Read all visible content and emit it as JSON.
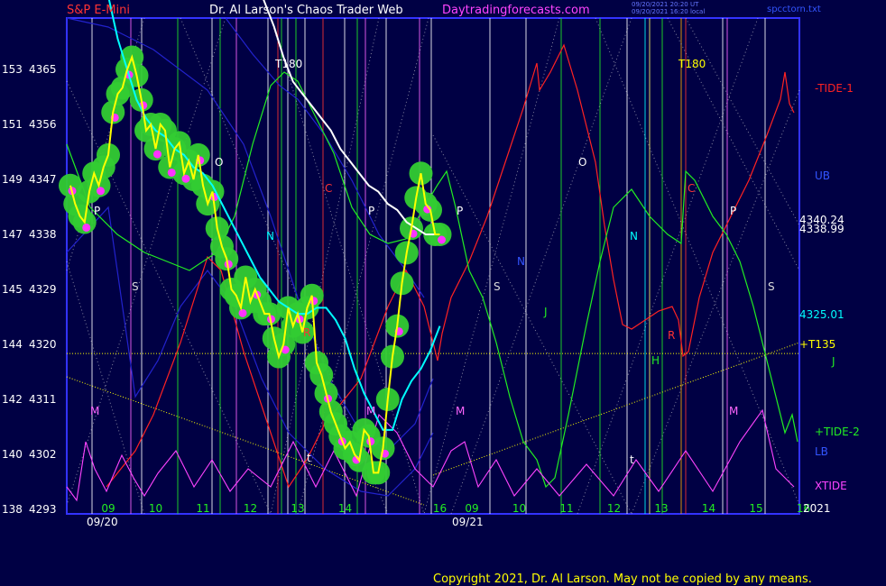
{
  "header": {
    "left_title": "S&P E-Mini",
    "center_title": "Dr. Al Larson's Chaos Trader Web",
    "site": "Daytradingforecasts.com",
    "timestamp_1": "09/20/2021 20:20 UT",
    "timestamp_2": "09/20/2021 16:20 local",
    "file_name": "spcctorn.txt"
  },
  "footer": {
    "copyright": "Copyright 2021, Dr. Al Larson. May not be copied by any means."
  },
  "colors": {
    "background": "#000044",
    "frame": "#3333ff",
    "price": "#ffff00",
    "ma_fast": "#00ffff",
    "ma_slow": "#ffffff",
    "tide1": "#ff2222",
    "tide2": "#22ee22",
    "xtide": "#ff44ff",
    "bands": "#2222cc",
    "highlight_green": "#33cc33",
    "highlight_magenta": "#ff33ff",
    "trend_dotted": "#ffff00"
  },
  "chart_data": {
    "type": "line",
    "title": "S&P E-Mini",
    "ylim": [
      4293,
      4370
    ],
    "y_ticks": [
      {
        "cycle": "153",
        "price": "4365",
        "v": 4365
      },
      {
        "cycle": "151",
        "price": "4356",
        "v": 4356
      },
      {
        "cycle": "149",
        "price": "4347",
        "v": 4347
      },
      {
        "cycle": "147",
        "price": "4338",
        "v": 4338
      },
      {
        "cycle": "145",
        "price": "4329",
        "v": 4329
      },
      {
        "cycle": "144",
        "price": "4320",
        "v": 4320
      },
      {
        "cycle": "142",
        "price": "4311",
        "v": 4311
      },
      {
        "cycle": "140",
        "price": "4302",
        "v": 4302
      },
      {
        "cycle": "138",
        "price": "4293",
        "v": 4293
      }
    ],
    "xlim": [
      8.0,
      16.9
    ],
    "x_ticks": [
      {
        "label": "09",
        "t": 8.8
      },
      {
        "label": "10",
        "t": 9.8
      },
      {
        "label": "11",
        "t": 10.8
      },
      {
        "label": "12",
        "t": 11.8
      },
      {
        "label": "13",
        "t": 12.8
      },
      {
        "label": "14",
        "t": 13.8
      },
      {
        "label": "16",
        "t": 15.8
      },
      {
        "label": "09",
        "t": 8.8,
        "day": 2
      },
      {
        "label": "10",
        "t": 9.8,
        "day": 2
      },
      {
        "label": "11",
        "t": 10.8,
        "day": 2
      },
      {
        "label": "12",
        "t": 11.8,
        "day": 2
      },
      {
        "label": "13",
        "t": 12.8,
        "day": 2
      },
      {
        "label": "14",
        "t": 13.8,
        "day": 2
      },
      {
        "label": "15",
        "t": 14.8,
        "day": 2
      },
      {
        "label": "16",
        "t": 15.8,
        "day": 2
      }
    ],
    "date_labels": [
      "09/20",
      "09/21"
    ],
    "year_label": "2021",
    "right_labels": {
      "tide1": "-TIDE-1",
      "ub": "UB",
      "p1": "4340.24",
      "p2": "4338.99",
      "p3": "4325.01",
      "t135": "+T135",
      "j": "J",
      "tide2": "+TIDE-2",
      "lb": "LB",
      "xtide": "XTIDE"
    },
    "t180_labels": [
      "T180",
      "T180"
    ],
    "level_line": 4318.5,
    "series": [
      {
        "name": "price",
        "x": [
          8.0,
          8.1,
          8.2,
          8.3,
          8.4,
          8.5,
          8.6,
          8.7,
          8.8,
          8.9,
          9.0,
          9.1,
          9.2,
          9.3,
          9.4,
          9.5,
          9.6,
          9.7,
          9.8,
          9.9,
          10.0,
          10.1,
          10.2,
          10.3,
          10.4,
          10.5,
          10.6,
          10.7,
          10.8,
          10.9,
          11.0,
          11.1,
          11.2,
          11.3,
          11.4,
          11.5,
          11.6,
          11.7,
          11.8,
          11.9,
          12.0,
          12.1,
          12.2,
          12.3,
          12.4,
          12.5,
          12.6,
          12.7,
          12.8,
          12.9,
          13.0,
          13.1,
          13.2,
          13.3,
          13.4,
          13.5,
          13.6,
          13.7,
          13.8,
          13.9,
          14.0,
          14.1,
          14.2,
          14.3,
          14.4,
          14.5,
          14.6,
          14.7,
          14.8,
          14.9,
          15.0,
          15.1,
          15.2,
          15.3,
          15.4,
          15.5,
          15.6,
          15.7,
          15.8
        ],
        "values": [
          4346,
          4343,
          4341,
          4340,
          4345,
          4348,
          4346,
          4349,
          4351,
          4358,
          4361,
          4362,
          4365,
          4367,
          4364,
          4360,
          4355,
          4356,
          4352,
          4356,
          4355,
          4349,
          4352,
          4353,
          4348,
          4350,
          4347,
          4351,
          4346,
          4343,
          4345,
          4339,
          4336,
          4334,
          4329,
          4328,
          4326,
          4331,
          4327,
          4329,
          4327,
          4325,
          4325,
          4321,
          4318,
          4320,
          4326,
          4323,
          4325,
          4322,
          4326,
          4328,
          4317,
          4315,
          4312,
          4309,
          4307,
          4305,
          4303,
          4304,
          4302,
          4301,
          4306,
          4305,
          4299,
          4299,
          4303,
          4311,
          4318,
          4323,
          4330,
          4335,
          4339,
          4344,
          4348,
          4343,
          4342,
          4338,
          4338
        ]
      },
      {
        "name": "ma_fast",
        "x": [
          8.8,
          9.0,
          9.2,
          9.4,
          9.6,
          9.8,
          10.0,
          10.2,
          10.4,
          10.6,
          10.8,
          11.0,
          11.2,
          11.4,
          11.6,
          11.8,
          12.0,
          12.2,
          12.4,
          12.6,
          12.8,
          13.0,
          13.2,
          13.4,
          13.6,
          13.8,
          14.0,
          14.2,
          14.4,
          14.6,
          14.8,
          15.0,
          15.2,
          15.4,
          15.6,
          15.8
        ],
        "values": [
          4377,
          4370,
          4365,
          4360,
          4357,
          4355,
          4354,
          4352,
          4351,
          4349,
          4348,
          4346,
          4343,
          4340,
          4337,
          4334,
          4331,
          4329,
          4327,
          4326,
          4325,
          4325,
          4326,
          4326,
          4324,
          4321,
          4316,
          4312,
          4309,
          4306,
          4306,
          4311,
          4314,
          4316,
          4319,
          4323
        ]
      },
      {
        "name": "ma_slow",
        "x": [
          11.9,
          12.1,
          12.3,
          12.5,
          12.7,
          12.9,
          13.1,
          13.3,
          13.5,
          13.7,
          13.9,
          14.1,
          14.3,
          14.5,
          14.7,
          14.9,
          15.1,
          15.3,
          15.5,
          15.8
        ],
        "values": [
          4380,
          4376,
          4372,
          4367,
          4363,
          4361,
          4359,
          4357,
          4355,
          4352,
          4350,
          4348,
          4346,
          4345,
          4343,
          4342,
          4340,
          4339,
          4338,
          4338
        ]
      }
    ],
    "annotations": [
      "P",
      "P",
      "P",
      "P",
      "S",
      "S",
      "S",
      "O",
      "O",
      "N",
      "N",
      "N",
      "C",
      "C",
      "R",
      "R",
      "J",
      "H",
      "M",
      "M",
      "M",
      "M",
      "t",
      "t"
    ]
  }
}
